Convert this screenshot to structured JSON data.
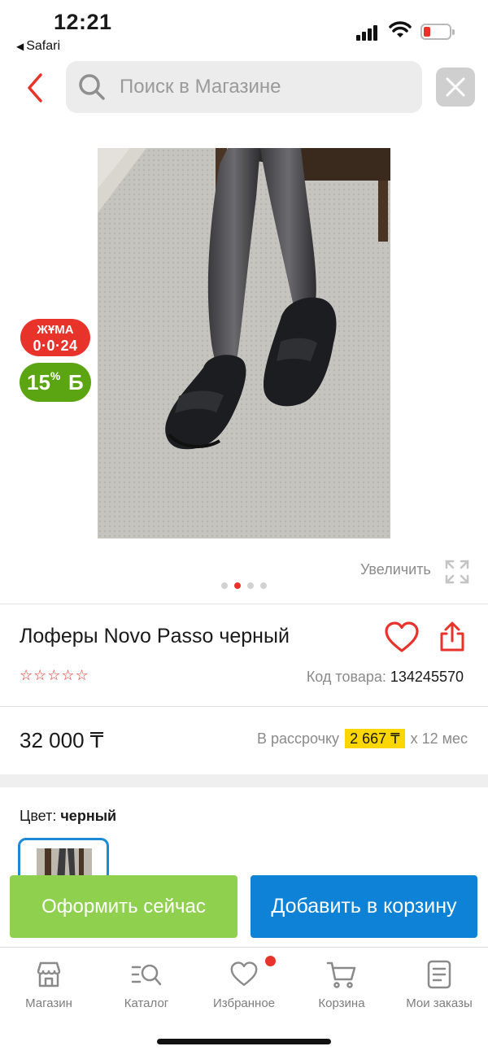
{
  "status_bar": {
    "time": "12:21",
    "back_app": "Safari",
    "battery_color": "#e8332b"
  },
  "header": {
    "search_placeholder": "Поиск в Магазине",
    "back_icon": "chevron-left-icon",
    "clear_icon": "close-icon"
  },
  "gallery": {
    "badge_juma_line1": "ЖҰМА",
    "badge_juma_line2": "0·0·24",
    "bonus_percent": "15",
    "bonus_percent_sign": "%",
    "bonus_currency": "Б",
    "zoom_label": "Увеличить",
    "slide_count": 4,
    "active_slide": 2
  },
  "product": {
    "title": "Лоферы Novo Passo черный",
    "rating_stars": "☆☆☆☆☆",
    "code_label": "Код товара:",
    "code_value": "134245570",
    "price": "32 000 ₸",
    "installment_label": "В рассрочку",
    "installment_amount": "2 667 ₸",
    "installment_term": "х 12 мес",
    "color_label": "Цвет:",
    "color_value": "черный"
  },
  "actions": {
    "buy_now": "Оформить сейчас",
    "add_to_cart": "Добавить в корзину"
  },
  "tabbar": {
    "items": [
      {
        "label": "Магазин",
        "icon": "store-icon"
      },
      {
        "label": "Каталог",
        "icon": "catalog-search-icon"
      },
      {
        "label": "Избранное",
        "icon": "heart-icon"
      },
      {
        "label": "Корзина",
        "icon": "cart-icon"
      },
      {
        "label": "Мои заказы",
        "icon": "orders-icon"
      }
    ]
  },
  "colors": {
    "accent_red": "#e8332b",
    "buy_now_green": "#8fd14f",
    "cart_blue": "#0d82d6",
    "installment_yellow": "#fcd600",
    "bonus_green": "#5ba412"
  }
}
